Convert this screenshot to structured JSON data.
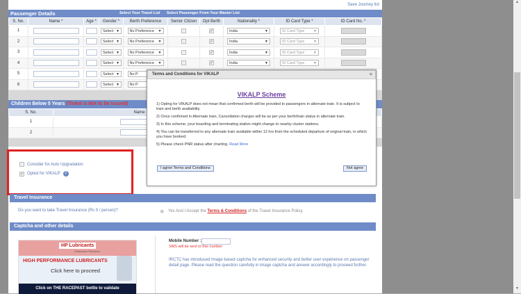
{
  "top": {
    "save_journey": "Save Journey list"
  },
  "passenger": {
    "title": "Passenger Details",
    "sub1": "Select Your Travel List",
    "sub2": "Select Passenger From Your Master List",
    "columns": [
      "S. No.",
      "Name *",
      "Age *",
      "Gender *",
      "Berth Preference",
      "Senior Citizen",
      "Opt Berth",
      "Nationality *",
      "ID Card Type *",
      "ID Card No. *"
    ],
    "rows": [
      {
        "sno": "1",
        "gender": "Select",
        "berth": "No Preference",
        "nationality": "India",
        "idtype": "ID Card Type"
      },
      {
        "sno": "2",
        "gender": "Select",
        "berth": "No Preference",
        "nationality": "India",
        "idtype": "ID Card Type"
      },
      {
        "sno": "3",
        "gender": "Select",
        "berth": "No Preference",
        "nationality": "India",
        "idtype": "ID Card Type"
      },
      {
        "sno": "4",
        "gender": "Select",
        "berth": "No Preference",
        "nationality": "India",
        "idtype": "ID Card Type"
      },
      {
        "sno": "5",
        "gender": "Select",
        "berth": "No P",
        "nationality": "",
        "idtype": ""
      },
      {
        "sno": "6",
        "gender": "Select",
        "berth": "No P",
        "nationality": "",
        "idtype": ""
      }
    ]
  },
  "children": {
    "title": "Children Below 5 Years",
    "note": "(Ticket is Not to be Issued)",
    "columns": [
      "S. No.",
      "Name"
    ],
    "rows": [
      {
        "sno": "1"
      },
      {
        "sno": "2"
      }
    ]
  },
  "options": {
    "auto_upgrade": "Consider for Auto Upgradation",
    "vikalp": "Opted for VIKALP",
    "help": "?"
  },
  "insurance": {
    "title": "Travel Insurance",
    "question": "Do you want to take Travel Insurance (Rs 0 / person)?",
    "answer_prefix": "Yes And I Accept the",
    "answer_link": "Terms & Conditions",
    "answer_suffix": "of the Travel Insurance Policy."
  },
  "captcha": {
    "title": "Captcha and other details",
    "mobile_label": "Mobile Number :",
    "sms_note": "SMS will be sent to this number",
    "irctc_note": "IRCTC has introduced Image based captcha for enhanced security and better user experience on passenger detail page. Please read the question carefully in image captcha and answer accordingly to proceed further."
  },
  "ad": {
    "logo": "HP Lubricants",
    "slogan": "Hindustan Petroleum",
    "headline": "HIGH PERFORMANCE LUBRICANTS",
    "click": "Click here to proceed",
    "bottom": "Click on THE RACEPAST bottle to validate"
  },
  "modal": {
    "header": "Terms and Conditions for VIKALP",
    "close": "×",
    "title": "VIKALP Scheme",
    "items": [
      "1) Opting for VIKALP does not mean that confirmed berth will be provided to passengers in alternate train. It is subject to train and berth availability.",
      "2) Once confirmed in Alternate train, Cancellation charges will be as per your berth/train status in alternate train.",
      "3) In this scheme, your boarding and terminating station might change to nearby cluster stations.",
      "4) You can be transferred to any alternate train available within 12 hrs from the scheduled departure of original train, in which you have booked."
    ],
    "item5": "5) Please check PNR status after charting.",
    "read_more": "Read More",
    "agree": "I agree Terms and Conditions",
    "disagree": "Not agree"
  }
}
